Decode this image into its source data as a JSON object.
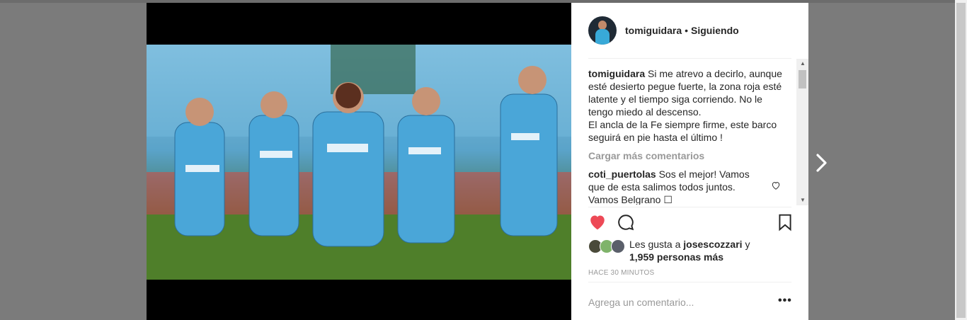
{
  "post": {
    "username": "tomiguidara",
    "separator": "•",
    "follow_status": "Siguiendo",
    "caption_lines": [
      "Si me atrevo a decirlo, aunque",
      "esté desierto pegue fuerte, la zona roja esté",
      "latente y el tiempo siga corriendo. No le",
      "tengo miedo al descenso.",
      "El ancla de la Fe siempre firme, este barco",
      "seguirá en pie hasta el último !"
    ],
    "load_more": "Cargar más comentarios",
    "comment": {
      "username": "coti_puertolas",
      "lines": [
        "Sos el mejor! Vamos",
        "que de esta salimos todos juntos.",
        "Vamos Belgrano ☐"
      ]
    },
    "likes": {
      "prefix": "Les gusta a",
      "user": "josescozzari",
      "conjunction": "y",
      "others": "1,959 personas más"
    },
    "timestamp": "HACE 30 MINUTOS",
    "comment_placeholder": "Agrega un comentario...",
    "more_options": "•••"
  },
  "icons": {
    "like": "heart-icon",
    "comment": "comment-icon",
    "save": "bookmark-icon",
    "next": "chevron-right-icon",
    "options": "more-icon"
  },
  "colors": {
    "like_active": "#ed4956",
    "text_primary": "#262626",
    "text_secondary": "#999999",
    "jersey": "#4aa6d8"
  }
}
